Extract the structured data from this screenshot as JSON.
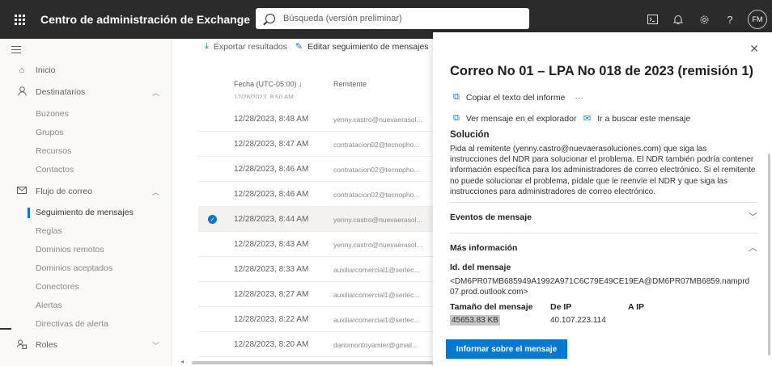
{
  "topbar": {
    "app_title": "Centro de administración de Exchange",
    "search_placeholder": "Búsqueda (versión preliminar)",
    "avatar_initials": "FM",
    "icons": [
      "terminal-icon",
      "bell-icon",
      "gear-icon",
      "help-icon"
    ],
    "help_glyph": "?"
  },
  "sidebar": {
    "items": [
      {
        "label": "Inicio",
        "icon": "home-icon"
      },
      {
        "label": "Destinatarios",
        "icon": "person-icon",
        "expanded": true
      },
      {
        "label": "Buzones"
      },
      {
        "label": "Grupos"
      },
      {
        "label": "Recursos"
      },
      {
        "label": "Contactos"
      },
      {
        "label": "Flujo de correo",
        "icon": "mail-icon",
        "expanded": true
      },
      {
        "label": "Seguimiento de mensajes",
        "active": true
      },
      {
        "label": "Reglas"
      },
      {
        "label": "Dominios remotos"
      },
      {
        "label": "Dominios aceptados"
      },
      {
        "label": "Conectores"
      },
      {
        "label": "Alertas"
      },
      {
        "label": "Directivas de alerta"
      },
      {
        "label": "Roles",
        "icon": "roles-icon",
        "expanded": false
      }
    ]
  },
  "toolbar": {
    "export_label": "Exportar resultados",
    "edit_label": "Editar seguimiento de mensajes"
  },
  "list": {
    "col_date": "Fecha (UTC-05:00)",
    "col_sort_glyph": "↓",
    "col_from": "Remitente",
    "clipped_row": "12/28/2023, 8:50 AM",
    "rows": [
      {
        "date": "12/28/2023, 8:48 AM",
        "from": "yenny.castro@nuevaerasol..."
      },
      {
        "date": "12/28/2023, 8:47 AM",
        "from": "contratacion02@tecnopho..."
      },
      {
        "date": "12/28/2023, 8:46 AM",
        "from": "contratacion02@tecnopho..."
      },
      {
        "date": "12/28/2023, 8:46 AM",
        "from": "contratacion02@tecnopho..."
      },
      {
        "date": "12/28/2023, 8:44 AM",
        "from": "yenny.castro@nuevaerasol...",
        "selected": true
      },
      {
        "date": "12/28/2023, 8:43 AM",
        "from": "yenny.castro@nuevaerasol..."
      },
      {
        "date": "12/28/2023, 8:33 AM",
        "from": "auxiliarcomercial1@serlec..."
      },
      {
        "date": "12/28/2023, 8:27 AM",
        "from": "auxiliarcomercial1@serlec..."
      },
      {
        "date": "12/28/2023, 8:22 AM",
        "from": "auxiliarcomercial1@serlec..."
      },
      {
        "date": "12/28/2023, 8:20 AM",
        "from": "dariomontoyamier@gmail..."
      }
    ]
  },
  "panel": {
    "title": "Correo No 01 – LPA No 018 de 2023 (remisión 1) SU...",
    "copy_report": "Copiar el texto del informe",
    "more_glyph": "···",
    "view_in_explorer": "Ver mensaje en el explorador",
    "go_search": "Ir a buscar este mensaje",
    "solution_heading": "Solución",
    "solution_text": "Pida al remitente (yenny.castro@nuevaerasoluciones.com) que siga las instrucciones del NDR para solucionar el problema. El NDR también podría contener información específica para los administradores de correo electrónico. Si el remitente no puede solucionar el problema, pídale que le reenvíe el NDR y que siga las instrucciones para administradores de correo electrónico.",
    "events_heading": "Eventos de mensaje",
    "more_info_heading": "Más información",
    "message_id_label": "Id. del mensaje",
    "message_id_value": "<DM6PR07MB685949A1992A971C6C79E49CE19EA@DM6PR07MB6859.namprd07.prod.outlook.com>",
    "size_label": "Tamaño del mensaje",
    "size_value": "45653.83 KB",
    "from_ip_label": "De IP",
    "from_ip_value": "40.107.223.114",
    "to_ip_label": "A IP",
    "report_button": "Informar sobre el mensaje"
  },
  "colors": {
    "accent": "#0078d4",
    "topbar": "#2b2b2b"
  }
}
